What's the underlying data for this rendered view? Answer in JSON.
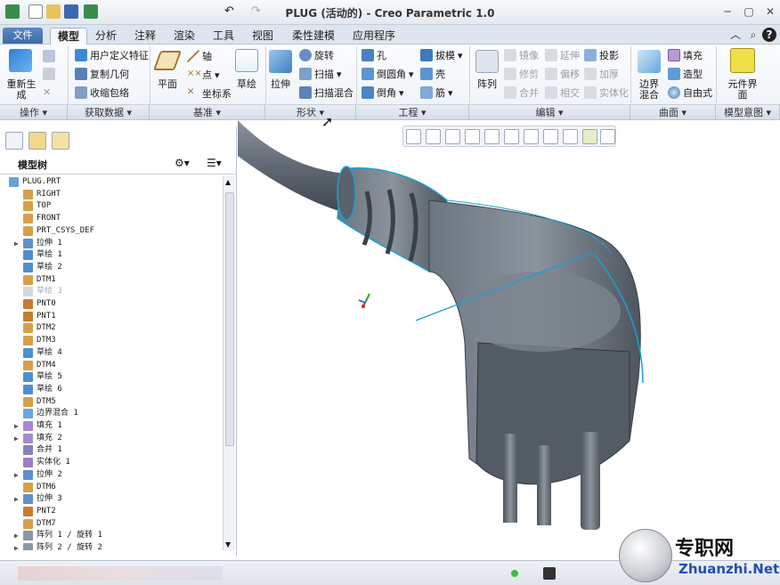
{
  "window": {
    "title": "PLUG (活动的) - Creo Parametric 1.0"
  },
  "menu": {
    "file": "文件"
  },
  "tabs": [
    "模型",
    "分析",
    "注释",
    "渲染",
    "工具",
    "视图",
    "柔性建模",
    "应用程序"
  ],
  "active_tab": "模型",
  "ribbon": {
    "operations": {
      "regenerate": "重新生成"
    },
    "get_data": {
      "user_feature": "用户定义特征",
      "copy_geometry": "复制几何",
      "shrinkwrap": "收缩包络"
    },
    "datum": {
      "plane": "平面",
      "axis": "轴",
      "point": "点",
      "csys": "坐标系"
    },
    "sketch": "草绘",
    "shapes": {
      "extrude": "拉伸",
      "revolve": "旋转",
      "sweep": "扫描",
      "swept_blend": "扫描混合"
    },
    "engineering": {
      "hole": "孔",
      "round": "倒圆角",
      "chamfer": "倒角",
      "draft": "拔模",
      "shell": "壳",
      "rib": "筋"
    },
    "pattern": "阵列",
    "editing": {
      "mirror": "镜像",
      "trim": "修剪",
      "merge": "合并",
      "extend": "延伸",
      "offset": "偏移",
      "intersect": "相交",
      "project": "投影",
      "thicken": "加厚",
      "solidify": "实体化"
    },
    "surfaces": {
      "boundary_blend": "边界混合",
      "fill": "填充",
      "style": "造型",
      "freestyle": "自由式"
    },
    "model_intent": {
      "component_interface": "元件界面"
    },
    "groups": [
      "操作",
      "获取数据",
      "基准",
      "形状",
      "工程",
      "编辑",
      "曲面",
      "模型意图"
    ]
  },
  "model_tree": {
    "title": "模型树",
    "items": [
      {
        "label": "PLUG.PRT",
        "icon": "part-icon",
        "expandable": false,
        "dim": false
      },
      {
        "label": "RIGHT",
        "icon": "datum-plane-icon",
        "expandable": false,
        "dim": false
      },
      {
        "label": "TOP",
        "icon": "datum-plane-icon",
        "expandable": false,
        "dim": false
      },
      {
        "label": "FRONT",
        "icon": "datum-plane-icon",
        "expandable": false,
        "dim": false
      },
      {
        "label": "PRT_CSYS_DEF",
        "icon": "csys-icon",
        "expandable": false,
        "dim": false
      },
      {
        "label": "拉伸 1",
        "icon": "extrude-icon",
        "expandable": true,
        "dim": false
      },
      {
        "label": "草绘 1",
        "icon": "sketch-icon",
        "expandable": false,
        "dim": false
      },
      {
        "label": "草绘 2",
        "icon": "sketch-icon",
        "expandable": false,
        "dim": false
      },
      {
        "label": "DTM1",
        "icon": "datum-plane-icon",
        "expandable": false,
        "dim": false
      },
      {
        "label": "草绘 3",
        "icon": "sketch-icon",
        "expandable": false,
        "dim": true
      },
      {
        "label": "PNT0",
        "icon": "datum-point-icon",
        "expandable": false,
        "dim": false
      },
      {
        "label": "PNT1",
        "icon": "datum-point-icon",
        "expandable": false,
        "dim": false
      },
      {
        "label": "DTM2",
        "icon": "datum-plane-icon",
        "expandable": false,
        "dim": false
      },
      {
        "label": "DTM3",
        "icon": "datum-plane-icon",
        "expandable": false,
        "dim": false
      },
      {
        "label": "草绘 4",
        "icon": "sketch-icon",
        "expandable": false,
        "dim": false
      },
      {
        "label": "DTM4",
        "icon": "datum-plane-icon",
        "expandable": false,
        "dim": false
      },
      {
        "label": "草绘 5",
        "icon": "sketch-icon",
        "expandable": false,
        "dim": false
      },
      {
        "label": "草绘 6",
        "icon": "sketch-icon",
        "expandable": false,
        "dim": false
      },
      {
        "label": "DTM5",
        "icon": "datum-plane-icon",
        "expandable": false,
        "dim": false
      },
      {
        "label": "边界混合 1",
        "icon": "boundary-blend-icon",
        "expandable": false,
        "dim": false
      },
      {
        "label": "填充 1",
        "icon": "fill-icon",
        "expandable": true,
        "dim": false
      },
      {
        "label": "填充 2",
        "icon": "fill-icon",
        "expandable": true,
        "dim": false
      },
      {
        "label": "合并 1",
        "icon": "merge-icon",
        "expandable": false,
        "dim": false
      },
      {
        "label": "实体化 1",
        "icon": "solidify-icon",
        "expandable": false,
        "dim": false
      },
      {
        "label": "拉伸 2",
        "icon": "extrude-icon",
        "expandable": true,
        "dim": false
      },
      {
        "label": "DTM6",
        "icon": "datum-plane-icon",
        "expandable": false,
        "dim": false
      },
      {
        "label": "拉伸 3",
        "icon": "extrude-icon",
        "expandable": true,
        "dim": false
      },
      {
        "label": "PNT2",
        "icon": "datum-point-icon",
        "expandable": false,
        "dim": false
      },
      {
        "label": "DTM7",
        "icon": "datum-plane-icon",
        "expandable": false,
        "dim": false
      },
      {
        "label": "阵列 1 / 旋转 1",
        "icon": "pattern-icon",
        "expandable": true,
        "dim": false
      },
      {
        "label": "阵列 2 / 旋转 2",
        "icon": "pattern-icon",
        "expandable": true,
        "dim": false
      }
    ]
  },
  "watermark": {
    "text": "专职网",
    "url": "Zhuanzhi.Net"
  },
  "colors": {
    "accent": "#3e6aa8",
    "model": "#5b6470",
    "datum": "#1aa0d0"
  }
}
